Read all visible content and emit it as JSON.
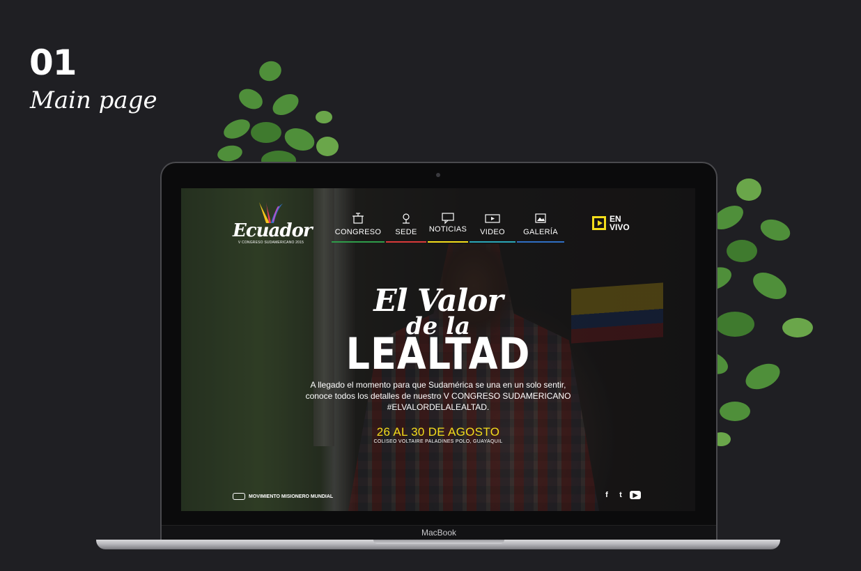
{
  "presentation": {
    "section_number": "01",
    "section_title": "Main page"
  },
  "laptop": {
    "brand": "MacBook"
  },
  "site": {
    "logo": {
      "word": "Ecuador",
      "subtitle": "V CONGRESO SUDAMERICANO 2015"
    },
    "nav": [
      {
        "label": "CONGRESO",
        "icon": "podium-icon",
        "color": "#2f9d4a"
      },
      {
        "label": "SEDE",
        "icon": "map-pin-icon",
        "color": "#d93a3a"
      },
      {
        "label": "NOTICIAS",
        "icon": "chat-bubble-icon",
        "color": "#f3dd1b"
      },
      {
        "label": "VIDEO",
        "icon": "video-camera-icon",
        "color": "#2aa6b8"
      },
      {
        "label": "GALERÍA",
        "icon": "image-icon",
        "color": "#2f6fc4"
      }
    ],
    "live": {
      "line1": "EN",
      "line2": "VIVO",
      "color": "#f3dd1b"
    },
    "hero": {
      "title_line1": "El Valor",
      "title_line2": "de la",
      "title_line3": "LEALTAD",
      "description_lines": [
        "A llegado el momento para que Sudamérica se una en un solo sentir,",
        "conoce todos los detalles de nuestro V CONGRESO SUDAMERICANO",
        "#ELVALORDELALEALTAD."
      ],
      "date": "26 AL 30 DE AGOSTO",
      "venue": "COLISEO VOLTAIRE PALADINES POLO, GUAYAQUIL"
    },
    "footer": {
      "organization": "MOVIMIENTO MISIONERO MUNDIAL",
      "social": [
        {
          "name": "facebook-icon",
          "glyph": "f"
        },
        {
          "name": "twitter-icon",
          "glyph": "t"
        },
        {
          "name": "youtube-icon",
          "glyph": "▶"
        }
      ]
    }
  }
}
